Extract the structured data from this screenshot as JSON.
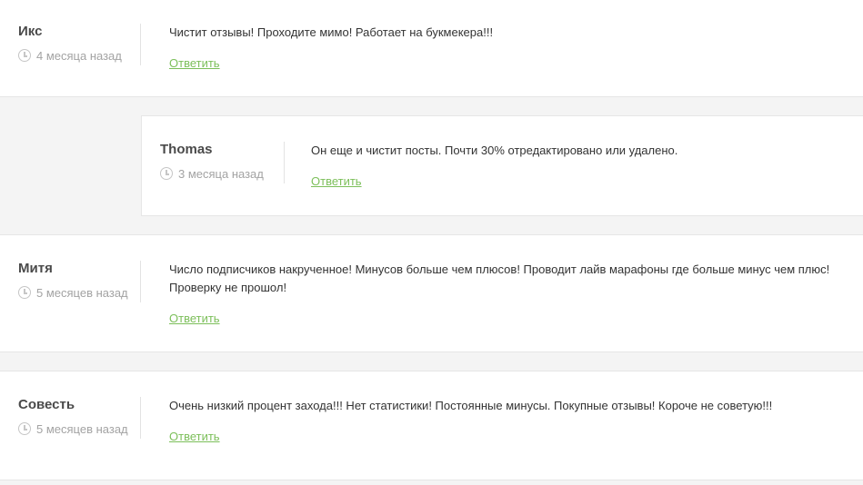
{
  "comments": [
    {
      "author": "Икс",
      "date": "4 месяца назад",
      "text": "Чистит отзывы! Проходите мимо! Работает на букмекера!!!",
      "reply_label": "Ответить"
    },
    {
      "author": "Thomas",
      "date": "3 месяца назад",
      "text": "Он еще и чистит посты. Почти 30% отредактировано или удалено.",
      "reply_label": "Ответить"
    },
    {
      "author": "Митя",
      "date": "5 месяцев назад",
      "text": "Число подписчиков накрученное! Минусов больше чем плюсов! Проводит лайв марафоны где больше минус чем плюс! Проверку не прошол!",
      "reply_label": "Ответить"
    },
    {
      "author": "Совесть",
      "date": "5 месяцев назад",
      "text": "Очень низкий процент захода!!! Нет статистики! Постоянные минусы. Покупные отзывы! Короче не советую!!!",
      "reply_label": "Ответить"
    }
  ],
  "colors": {
    "accent_link": "#7cbf5a",
    "background": "#f4f4f4",
    "card": "#ffffff"
  },
  "icons": {
    "date": "clock-icon"
  }
}
